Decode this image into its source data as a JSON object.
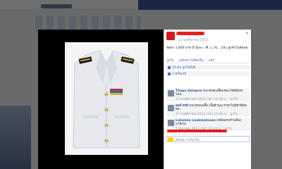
{
  "post": {
    "timestamp": "· 13 พฤศจิกายน 2012 ·",
    "body": "ชุดละ 1,800 บาท มี Size= M, L, XL , 2XL ลูกค้าไม่ต้องสะ",
    "actions": [
      "ถูกใจ",
      "แสดงความคิดเห็น",
      "แชร์"
    ]
  },
  "stats": {
    "likes": "10 คน ถูกใจสิ่งนี้",
    "shares": "2 ครั้งแชร์"
  },
  "comments": [
    {
      "author": "Thapa Sompon",
      "text": "ขนาดของเสื้อแต่ละไซต์มีตรงไหน",
      "time": "13 พฤศจิกายน 2012 เวลา 15:30 น. · ถูกใจ"
    },
    {
      "author": "คงค์ ศรดี",
      "text": "ขนาดของเสื้อ เนื้อผ้าและราคาไม่มีตัวคิดดต่อ",
      "time": "17 พฤศจิกายน 2012 เวลา 14:06 น. · ถูกใจ"
    },
    {
      "author": "Lukuana Lookmalanan",
      "text": "เหมือนกับร้านอื่นๆ มายังนะ",
      "time": "7 ธันวาคม 2012 เวลา 12:03 น. · ถูกใจ"
    }
  ],
  "write_comment": {
    "placeholder": "เขียนความคิดเห็น..."
  },
  "colors": {
    "accent": "#4267b2",
    "redact": "#ea1c1c"
  }
}
